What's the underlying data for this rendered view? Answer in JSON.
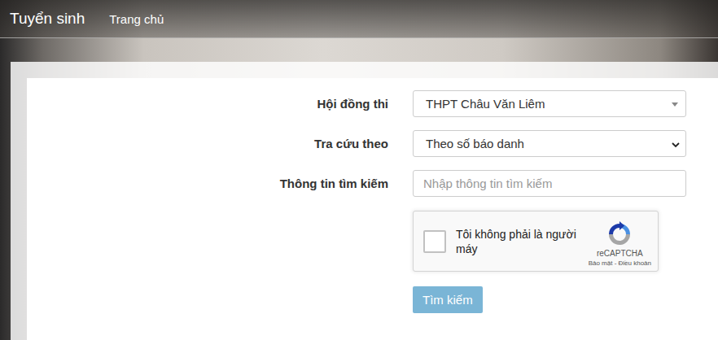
{
  "navbar": {
    "brand": "Tuyển sinh",
    "links": [
      {
        "label": "Trang chủ"
      }
    ]
  },
  "form": {
    "fields": [
      {
        "label": "Hội đồng thi",
        "kind": "select2",
        "value": "THPT Châu Văn Liêm"
      },
      {
        "label": "Tra cứu theo",
        "kind": "select",
        "value": "Theo số báo danh"
      },
      {
        "label": "Thông tin tìm kiếm",
        "kind": "input",
        "placeholder": "Nhập thông tin tìm kiếm"
      }
    ],
    "captcha": {
      "label": "Tôi không phải là người máy",
      "brand": "reCAPTCHA",
      "links": "Bảo mật - Điều khoản",
      "checked": false
    },
    "submit": {
      "label": "Tìm kiếm"
    }
  }
}
